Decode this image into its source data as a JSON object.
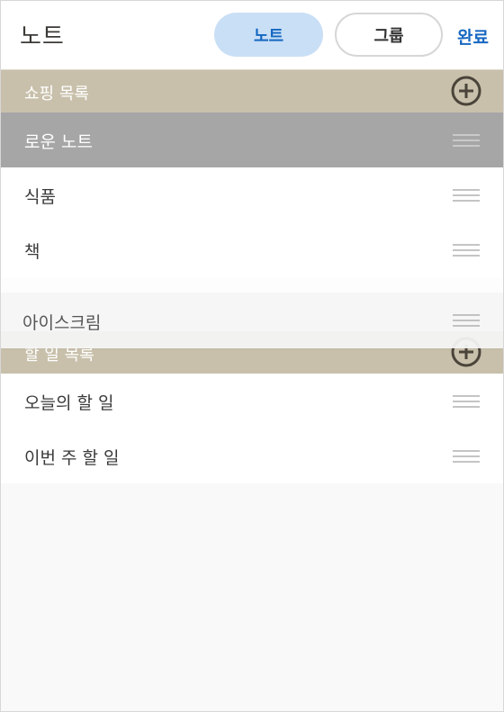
{
  "header": {
    "title": "노트",
    "tabs": [
      {
        "label": "노트",
        "selected": true
      },
      {
        "label": "그룹",
        "selected": false
      }
    ],
    "done_label": "완료"
  },
  "sections": [
    {
      "title": "쇼핑 목록",
      "add_icon": "plus-circle-icon",
      "items": [
        {
          "label": "로운 노트",
          "state": "selected"
        },
        {
          "label": "식품"
        },
        {
          "label": "책"
        }
      ]
    },
    {
      "title": "할 일 목록",
      "add_icon": "plus-circle-icon",
      "items": [
        {
          "label": "오늘의 할 일"
        },
        {
          "label": "이번 주 할 일"
        }
      ]
    }
  ],
  "dragging_item": {
    "label": "아이스크림"
  },
  "colors": {
    "section_bar": "#c8c0ab",
    "selected_row": "#a6a6a6",
    "accent": "#1667c1",
    "tab_selected_bg": "#c9dff6"
  }
}
